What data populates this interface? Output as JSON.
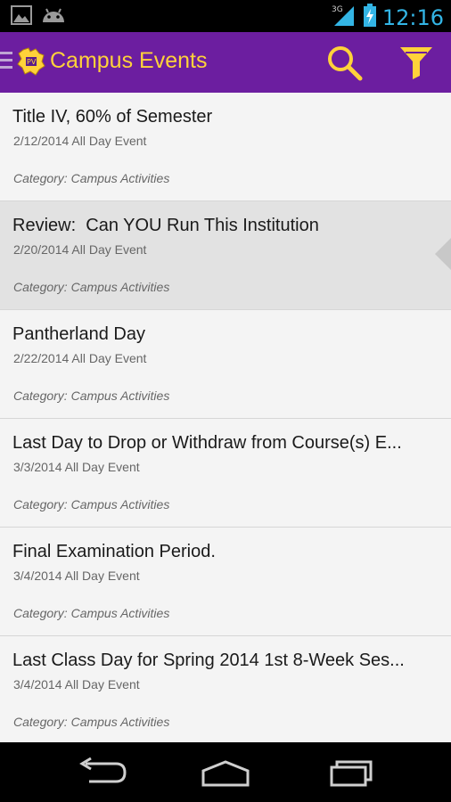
{
  "status_bar": {
    "time": "12:16",
    "network": "3G",
    "icons": [
      "image-notification-icon",
      "android-notification-icon",
      "signal-icon",
      "battery-charging-icon"
    ]
  },
  "action_bar": {
    "title": "Campus Events",
    "background": "#6c1ea0",
    "title_color": "#ffd23a",
    "icons": [
      "menu-icon",
      "app-logo-icon",
      "search-icon",
      "filter-icon"
    ]
  },
  "events": [
    {
      "title": "Title IV, 60% of Semester",
      "date": "2/12/2014 All Day Event",
      "category": "Category: Campus Activities",
      "selected": false
    },
    {
      "title": "Review:  Can YOU Run This Institution",
      "date": "2/20/2014 All Day Event",
      "category": "Category: Campus Activities",
      "selected": true
    },
    {
      "title": "Pantherland Day",
      "date": "2/22/2014 All Day Event",
      "category": "Category: Campus Activities",
      "selected": false
    },
    {
      "title": "Last Day to Drop or Withdraw from Course(s) E...",
      "date": "3/3/2014 All Day Event",
      "category": "Category: Campus Activities",
      "selected": false
    },
    {
      "title": "Final Examination Period.",
      "date": "3/4/2014 All Day Event",
      "category": "Category: Campus Activities",
      "selected": false
    },
    {
      "title": "Last Class Day for Spring 2014 1st 8-Week Ses...",
      "date": "3/4/2014 All Day Event",
      "category": "Category: Campus Activities",
      "selected": false
    }
  ],
  "nav_bar": {
    "icons": [
      "back-icon",
      "home-icon",
      "recent-apps-icon"
    ]
  }
}
